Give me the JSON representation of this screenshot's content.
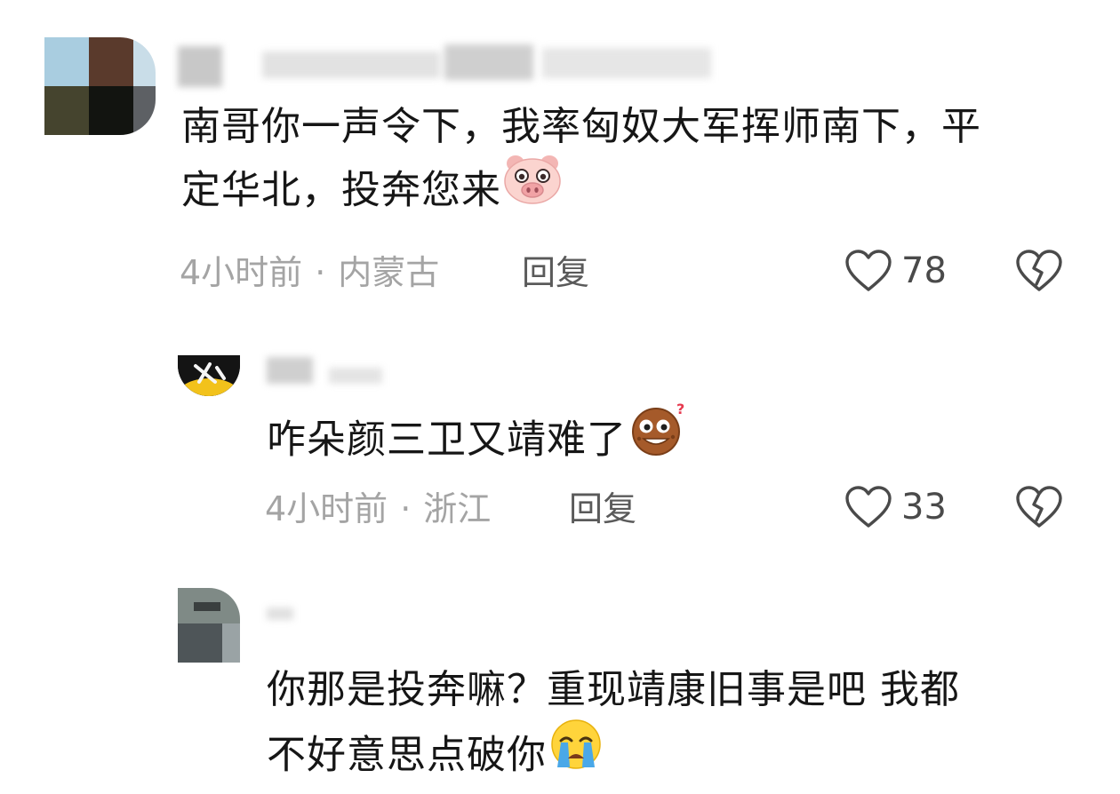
{
  "comments": [
    {
      "text_lines": [
        "南哥你一声令下，我率匈奴大军挥师南下，平",
        "定华北，投奔您来"
      ],
      "emoji": "pig-face-emoji",
      "time": "4小时前",
      "separator": "·",
      "location": "内蒙古",
      "reply_label": "回复",
      "likes": "78"
    },
    {
      "text_lines": [
        "咋朵颜三卫又靖难了"
      ],
      "emoji": "sweating-cookie-emoji",
      "time": "4小时前",
      "separator": "·",
      "location": "浙江",
      "reply_label": "回复",
      "likes": "33"
    },
    {
      "text_lines": [
        "你那是投奔嘛？重现靖康旧事是吧 我都",
        "不好意思点破你"
      ],
      "emoji": "crying-face-emoji"
    }
  ],
  "colors": {
    "text": "#161616",
    "meta": "#a4a4a4",
    "reply": "#5a5a5a",
    "icon": "#4a4a4a"
  },
  "icons": {
    "like": "heart-outline-icon",
    "dislike": "broken-heart-icon"
  }
}
